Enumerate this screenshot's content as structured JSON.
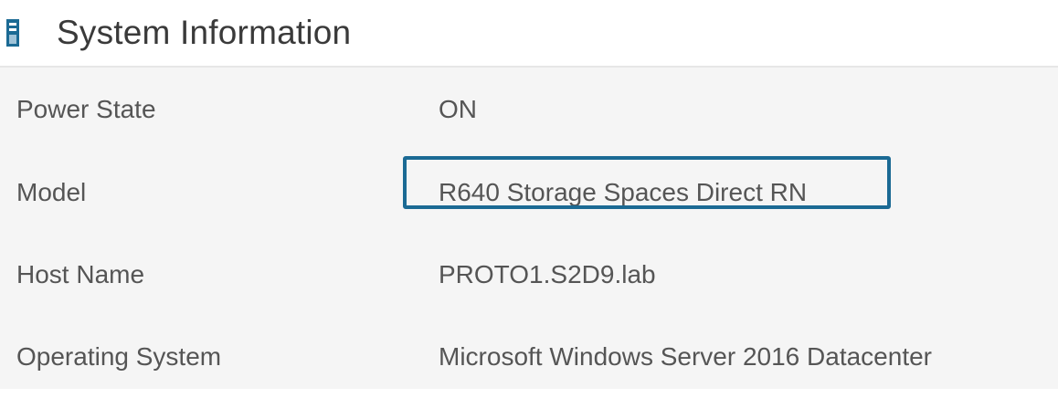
{
  "header": {
    "icon": "server-icon",
    "title": "System Information"
  },
  "rows": [
    {
      "label": "Power State",
      "value": "ON"
    },
    {
      "label": "Model",
      "value": "R640 Storage Spaces Direct RN"
    },
    {
      "label": "Host Name",
      "value": "PROTO1.S2D9.lab"
    },
    {
      "label": "Operating System",
      "value": "Microsoft Windows Server 2016 Datacenter"
    }
  ],
  "colors": {
    "highlight": "#1b6a94",
    "icon": "#1b6a94",
    "panel_background": "#f5f5f5"
  }
}
